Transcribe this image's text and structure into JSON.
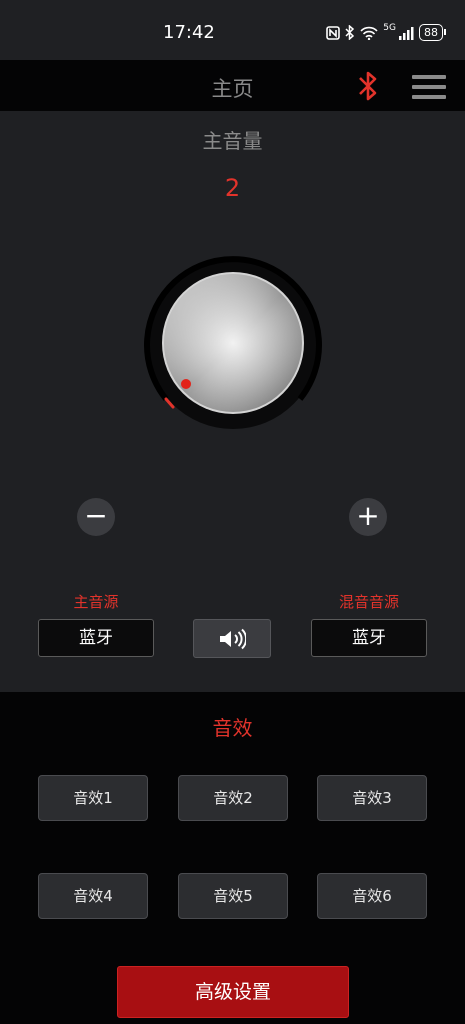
{
  "status_bar": {
    "time": "17:42",
    "signal": "5G",
    "battery": "88"
  },
  "header": {
    "title": "主页"
  },
  "volume": {
    "label": "主音量",
    "value": "2",
    "decrease_symbol": "−",
    "increase_symbol": "+"
  },
  "sources": {
    "main": {
      "label": "主音源",
      "value": "蓝牙"
    },
    "mix": {
      "label": "混音音源",
      "value": "蓝牙"
    }
  },
  "effects": {
    "title": "音效",
    "buttons": [
      "音效1",
      "音效2",
      "音效3",
      "音效4",
      "音效5",
      "音效6"
    ]
  },
  "advanced": {
    "label": "高级设置"
  },
  "colors": {
    "accent": "#e2332b",
    "panel": "#1f2023",
    "background": "#040405",
    "advanced_button": "#a80f12"
  }
}
